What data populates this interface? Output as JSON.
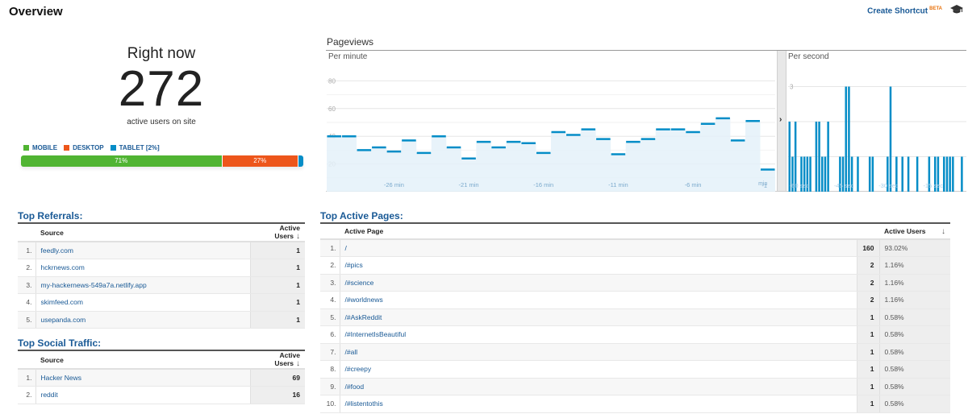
{
  "header": {
    "title": "Overview",
    "shortcut_label": "Create Shortcut",
    "shortcut_badge": "BETA"
  },
  "right_now": {
    "label": "Right now",
    "count": "272",
    "subtitle": "active users on site"
  },
  "devices": {
    "legend": [
      {
        "label": "MOBILE",
        "color": "#50b432"
      },
      {
        "label": "DESKTOP",
        "color": "#ed561b"
      },
      {
        "label": "TABLET [2%]",
        "color": "#058dc7"
      }
    ],
    "segments": [
      {
        "name": "mobile",
        "percent": 71,
        "label": "71%",
        "color": "#50b432"
      },
      {
        "name": "desktop",
        "percent": 27,
        "label": "27%",
        "color": "#ed561b"
      },
      {
        "name": "tablet",
        "percent": 2,
        "label": "",
        "color": "#058dc7"
      }
    ]
  },
  "pageviews": {
    "title": "Pageviews",
    "per_minute_label": "Per minute",
    "per_second_label": "Per second",
    "divider_icon": "chevron-right-icon",
    "divider_glyph": "›"
  },
  "chart_data": [
    {
      "type": "line",
      "title": "Pageviews Per minute",
      "xlabel": "",
      "ylabel": "",
      "ylim": [
        0,
        100
      ],
      "yticks": [
        20,
        40,
        60,
        80
      ],
      "xtick_labels": [
        "-26 min",
        "-21 min",
        "-16 min",
        "-11 min",
        "-6 min",
        "-1 min"
      ],
      "xtick_indices": [
        4,
        9,
        14,
        19,
        24,
        29
      ],
      "x": [
        -30,
        -29,
        -28,
        -27,
        -26,
        -25,
        -24,
        -23,
        -22,
        -21,
        -20,
        -19,
        -18,
        -17,
        -16,
        -15,
        -14,
        -13,
        -12,
        -11,
        -10,
        -9,
        -8,
        -7,
        -6,
        -5,
        -4,
        -3,
        -2,
        -1
      ],
      "values": [
        40,
        40,
        30,
        32,
        29,
        37,
        28,
        40,
        32,
        24,
        36,
        32,
        36,
        35,
        28,
        43,
        41,
        45,
        38,
        27,
        36,
        38,
        45,
        45,
        43,
        49,
        53,
        37,
        51,
        16
      ],
      "grid": true,
      "color": "#058dc7",
      "fill": "#e4f1f9"
    },
    {
      "type": "bar",
      "title": "Pageviews Per second",
      "ylim": [
        0,
        4
      ],
      "yticks": [
        1,
        2,
        3
      ],
      "xtick_labels": [
        "-60 sec",
        "-45 sec",
        "-30 sec",
        "-15 sec"
      ],
      "xtick_seconds": [
        -60,
        -45,
        -30,
        -15
      ],
      "x": [
        -60,
        -59,
        -58,
        -57,
        -56,
        -55,
        -54,
        -53,
        -52,
        -51,
        -50,
        -49,
        -48,
        -47,
        -46,
        -45,
        -44,
        -43,
        -42,
        -41,
        -40,
        -39,
        -38,
        -37,
        -36,
        -35,
        -34,
        -33,
        -32,
        -31,
        -30,
        -29,
        -28,
        -27,
        -26,
        -25,
        -24,
        -23,
        -22,
        -21,
        -20,
        -19,
        -18,
        -17,
        -16,
        -15,
        -14,
        -13,
        -12,
        -11,
        -10,
        -9,
        -8,
        -7,
        -6,
        -5,
        -4,
        -3,
        -2,
        -1
      ],
      "values": [
        2,
        1,
        2,
        0,
        1,
        1,
        1,
        1,
        0,
        2,
        2,
        1,
        1,
        2,
        0,
        0,
        0,
        1,
        1,
        3,
        3,
        1,
        0,
        1,
        0,
        0,
        0,
        1,
        1,
        0,
        0,
        0,
        0,
        1,
        3,
        0,
        1,
        0,
        1,
        0,
        1,
        0,
        0,
        1,
        0,
        0,
        0,
        1,
        0,
        1,
        1,
        0,
        1,
        1,
        1,
        1,
        0,
        0,
        1,
        0
      ],
      "grid": true,
      "color": "#058dc7"
    }
  ],
  "top_referrals": {
    "title": "Top Referrals:",
    "columns": [
      "Source",
      "Active Users"
    ],
    "rows": [
      {
        "rank": "1.",
        "source": "feedly.com",
        "users": "1"
      },
      {
        "rank": "2.",
        "source": "hckrnews.com",
        "users": "1"
      },
      {
        "rank": "3.",
        "source": "my-hackernews-549a7a.netlify.app",
        "users": "1"
      },
      {
        "rank": "4.",
        "source": "skimfeed.com",
        "users": "1"
      },
      {
        "rank": "5.",
        "source": "usepanda.com",
        "users": "1"
      }
    ]
  },
  "top_social": {
    "title": "Top Social Traffic:",
    "columns": [
      "Source",
      "Active Users"
    ],
    "rows": [
      {
        "rank": "1.",
        "source": "Hacker News",
        "users": "69"
      },
      {
        "rank": "2.",
        "source": "reddit",
        "users": "16"
      }
    ]
  },
  "top_pages": {
    "title": "Top Active Pages:",
    "columns": [
      "Active Page",
      "Active Users"
    ],
    "rows": [
      {
        "rank": "1.",
        "page": "/",
        "users": "160",
        "pct": "93.02%"
      },
      {
        "rank": "2.",
        "page": "/#pics",
        "users": "2",
        "pct": "1.16%"
      },
      {
        "rank": "3.",
        "page": "/#science",
        "users": "2",
        "pct": "1.16%"
      },
      {
        "rank": "4.",
        "page": "/#worldnews",
        "users": "2",
        "pct": "1.16%"
      },
      {
        "rank": "5.",
        "page": "/#AskReddit",
        "users": "1",
        "pct": "0.58%"
      },
      {
        "rank": "6.",
        "page": "/#InternetIsBeautiful",
        "users": "1",
        "pct": "0.58%"
      },
      {
        "rank": "7.",
        "page": "/#all",
        "users": "1",
        "pct": "0.58%"
      },
      {
        "rank": "8.",
        "page": "/#creepy",
        "users": "1",
        "pct": "0.58%"
      },
      {
        "rank": "9.",
        "page": "/#food",
        "users": "1",
        "pct": "0.58%"
      },
      {
        "rank": "10.",
        "page": "/#listentothis",
        "users": "1",
        "pct": "0.58%"
      }
    ]
  }
}
